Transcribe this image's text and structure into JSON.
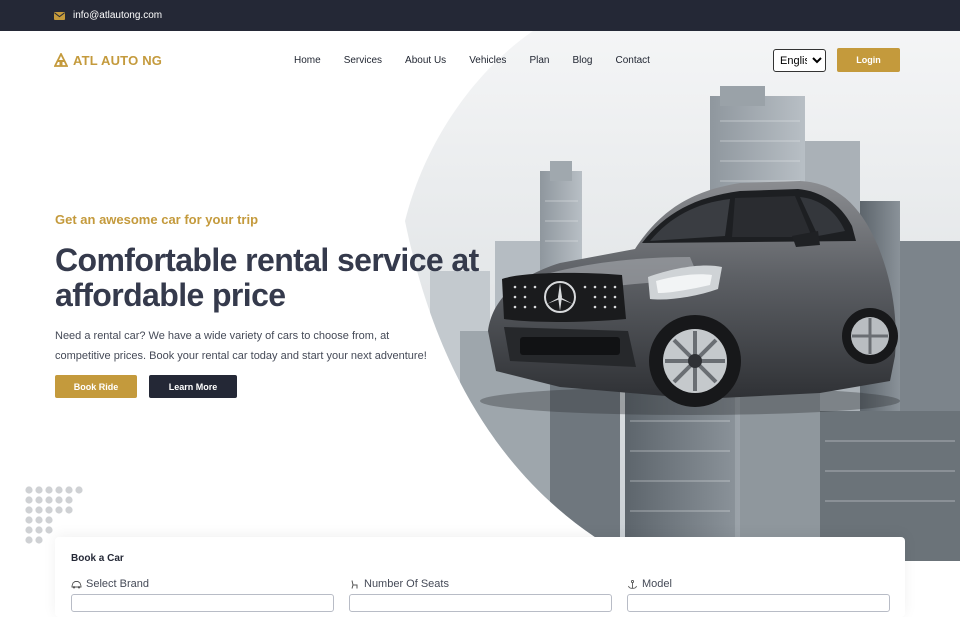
{
  "topbar": {
    "email": "info@atlautong.com",
    "mail_icon": "envelope-icon"
  },
  "brand": {
    "name": "ATL AUTO NG",
    "color": "#c49a3c"
  },
  "nav": {
    "items": [
      {
        "label": "Home"
      },
      {
        "label": "Services"
      },
      {
        "label": "About Us"
      },
      {
        "label": "Vehicles"
      },
      {
        "label": "Plan"
      },
      {
        "label": "Blog"
      },
      {
        "label": "Contact"
      }
    ],
    "language": "English",
    "login_label": "Login"
  },
  "hero": {
    "tagline": "Get an awesome car for your trip",
    "headline": "Comfortable rental service at\naffordable price",
    "description": "Need a rental car? We have a wide variety of cars to choose from, at\ncompetitive prices. Book your rental car today and start your next adventure!",
    "book_label": "Book Ride",
    "learn_label": "Learn More"
  },
  "booking": {
    "title": "Book a Car",
    "fields": [
      {
        "label": "Select Brand",
        "icon": "car-icon"
      },
      {
        "label": "Number Of Seats",
        "icon": "seat-icon"
      },
      {
        "label": "Model",
        "icon": "anchor-icon"
      }
    ]
  },
  "colors": {
    "accent": "#c49a3c",
    "dark": "#242836",
    "headline": "#353a4c"
  }
}
